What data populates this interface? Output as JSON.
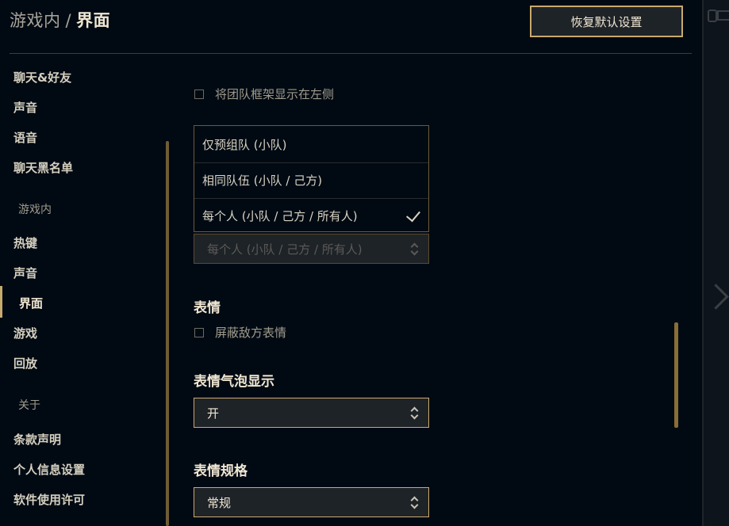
{
  "header": {
    "section": "游戏内",
    "separator": "/",
    "page": "界面",
    "reset_label": "恢复默认设置"
  },
  "sidebar": {
    "items": [
      {
        "label": "聊天&好友",
        "kind": "item"
      },
      {
        "label": "声音",
        "kind": "item"
      },
      {
        "label": "语音",
        "kind": "item"
      },
      {
        "label": "聊天黑名单",
        "kind": "item"
      },
      {
        "label": "游戏内",
        "kind": "group"
      },
      {
        "label": "热键",
        "kind": "item"
      },
      {
        "label": "声音",
        "kind": "item"
      },
      {
        "label": "界面",
        "kind": "item",
        "active": true
      },
      {
        "label": "游戏",
        "kind": "item"
      },
      {
        "label": "回放",
        "kind": "item"
      },
      {
        "label": "关于",
        "kind": "group"
      },
      {
        "label": "条款声明",
        "kind": "item"
      },
      {
        "label": "个人信息设置",
        "kind": "item"
      },
      {
        "label": "软件使用许可",
        "kind": "item"
      }
    ]
  },
  "content": {
    "team_frames_left_label": "将团队框架显示在左侧",
    "dropdown_options": [
      "仅预组队 (小队)",
      "相同队伍 (小队 / 己方)",
      "每个人 (小队 / 己方 / 所有人)"
    ],
    "dropdown_selected_index": 2,
    "dropdown_current_value": "每个人 (小队 / 己方 / 所有人)",
    "emotes_title": "表情",
    "mute_enemy_emotes_label": "屏蔽敌方表情",
    "emote_bubble_title": "表情气泡显示",
    "emote_bubble_value": "开",
    "emote_size_title": "表情规格",
    "emote_size_value": "常规"
  },
  "colors": {
    "background": "#010a13",
    "gold": "#c8aa6e",
    "text": "#f0e6d2"
  }
}
